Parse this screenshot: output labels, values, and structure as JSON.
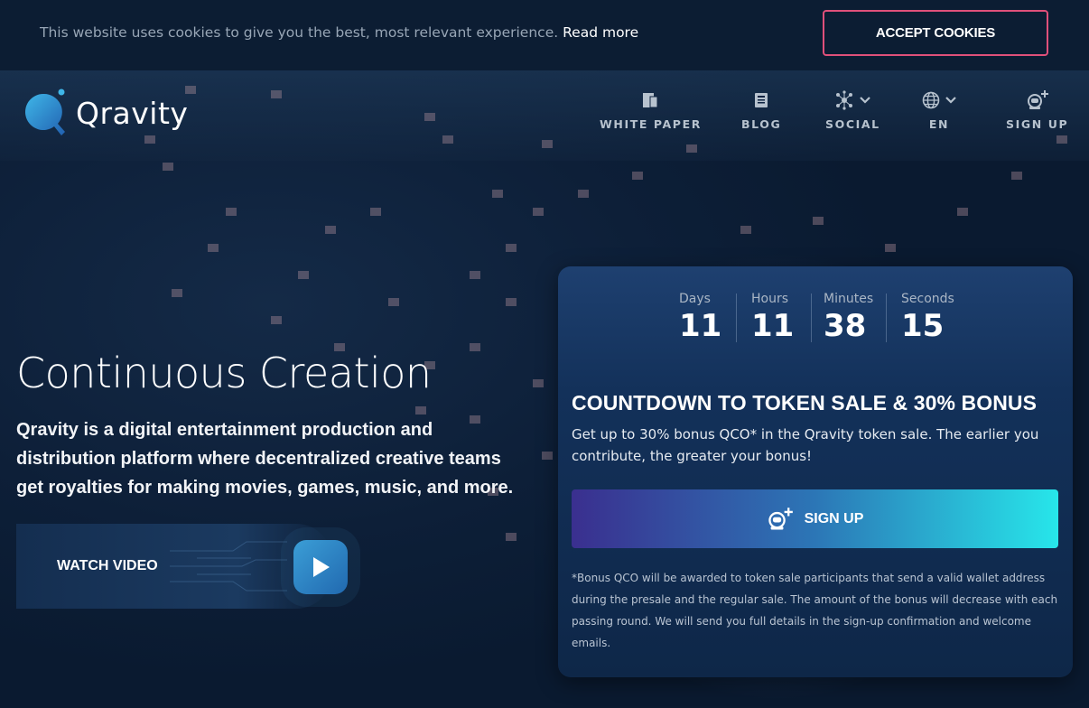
{
  "cookie_bar": {
    "message": "This website uses cookies to give you the best, most relevant experience.",
    "link": "Read more",
    "accept_label": "ACCEPT COOKIES"
  },
  "header": {
    "logo_text": "Qravity",
    "nav": [
      {
        "label": "WHITE PAPER",
        "icon": "document-icon"
      },
      {
        "label": "BLOG",
        "icon": "newspaper-icon"
      },
      {
        "label": "SOCIAL",
        "icon": "network-icon"
      },
      {
        "label": "EN",
        "icon": "globe-icon"
      },
      {
        "label": "SIGN UP",
        "icon": "astronaut-plus-icon"
      }
    ]
  },
  "hero": {
    "title": "Continuous Creation",
    "description": "Qravity is a digital entertainment production and distribution platform where decentralized creative teams get royalties for making movies, games, music, and more.",
    "watch_label": "WATCH VIDEO"
  },
  "countdown": {
    "units": [
      {
        "label": "Days",
        "value": "11"
      },
      {
        "label": "Hours",
        "value": "11"
      },
      {
        "label": "Minutes",
        "value": "38"
      },
      {
        "label": "Seconds",
        "value": "15"
      }
    ],
    "title": "COUNTDOWN TO TOKEN SALE & 30% BONUS",
    "text": "Get up to 30% bonus QCO* in the Qravity token sale. The earlier you contribute, the greater your bonus!",
    "signup_label": "SIGN UP",
    "note": "*Bonus QCO will be awarded to token sale participants that send a valid wallet address during the presale and the regular sale. The amount of the bonus will decrease with each passing round. We will send you full details in the sign-up confirmation and welcome emails."
  },
  "colors": {
    "accent_pink": "#e0507a",
    "gradient_start": "#3a2f8f",
    "gradient_end": "#27e6ea",
    "play_blue": "#3b9ed6"
  }
}
